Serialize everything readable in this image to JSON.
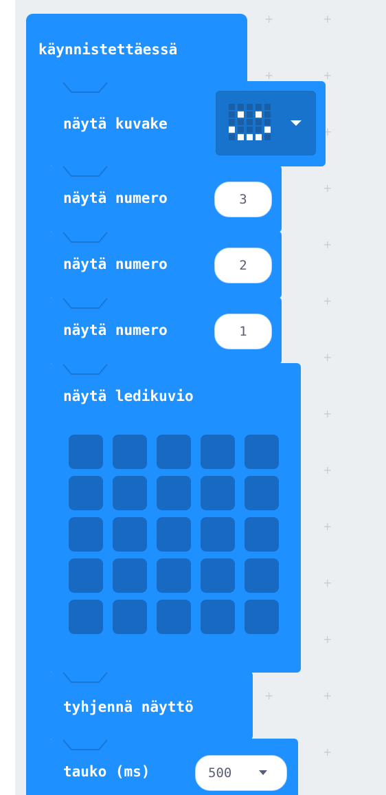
{
  "on_start": {
    "label": "käynnistettäessä"
  },
  "show_icon": {
    "label": "näytä kuvake",
    "icon": "happy-face-icon"
  },
  "show_number_blocks": [
    {
      "label": "näytä numero",
      "value": "3"
    },
    {
      "label": "näytä numero",
      "value": "2"
    },
    {
      "label": "näytä numero",
      "value": "1"
    }
  ],
  "show_leds": {
    "label": "näytä ledikuvio",
    "rows": 5,
    "cols": 5
  },
  "clear_screen": {
    "label": "tyhjennä näyttö"
  },
  "pause": {
    "label": "tauko (ms)",
    "value": "500"
  },
  "colors": {
    "block": "#1e90ff",
    "led_off": "#1769c2",
    "workspace": "#eceff1"
  }
}
